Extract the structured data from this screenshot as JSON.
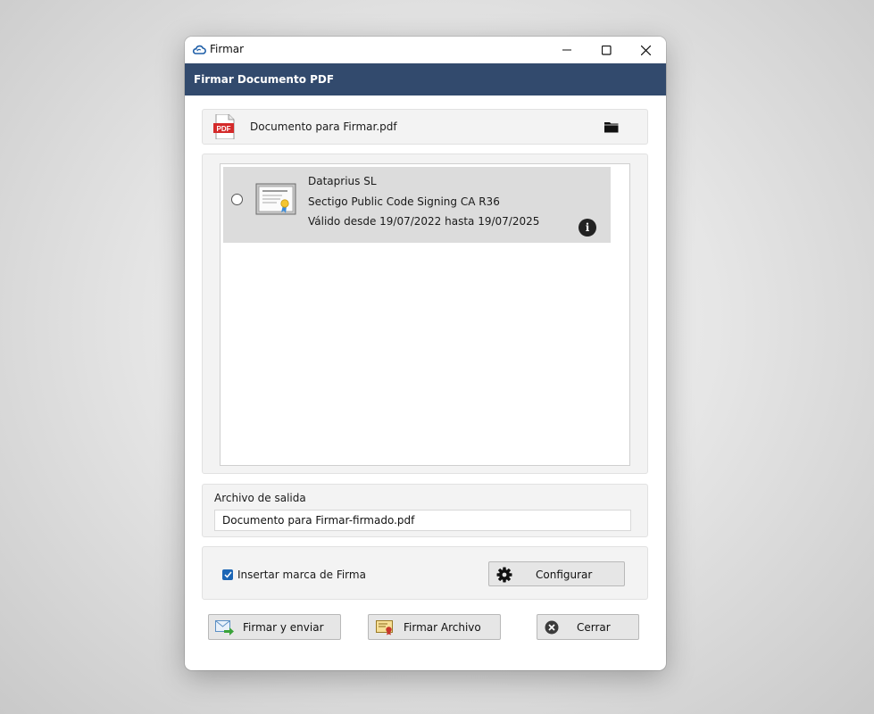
{
  "window": {
    "title": "Firmar",
    "header_title": "Firmar Documento PDF"
  },
  "file": {
    "name": "Documento para Firmar.pdf",
    "icon_label": "PDF",
    "icon": "pdf-file-icon",
    "browse_icon": "folder-icon"
  },
  "certificates": [
    {
      "holder": "Dataprius SL",
      "issuer": "Sectigo Public Code Signing CA R36",
      "validity": "Válido desde 19/07/2022 hasta 19/07/2025",
      "selected": false,
      "info_glyph": "i"
    }
  ],
  "output": {
    "label": "Archivo de salida",
    "value": "Documento para Firmar-firmado.pdf"
  },
  "options": {
    "insert_mark_label": "Insertar marca de Firma",
    "insert_mark_checked": true,
    "configure_label": "Configurar"
  },
  "actions": {
    "sign_send_label": "Firmar y enviar",
    "sign_file_label": "Firmar Archivo",
    "close_label": "Cerrar"
  },
  "colors": {
    "header": "#324a6d",
    "checkbox": "#1b65b5",
    "pdf_red": "#d42a2a"
  }
}
